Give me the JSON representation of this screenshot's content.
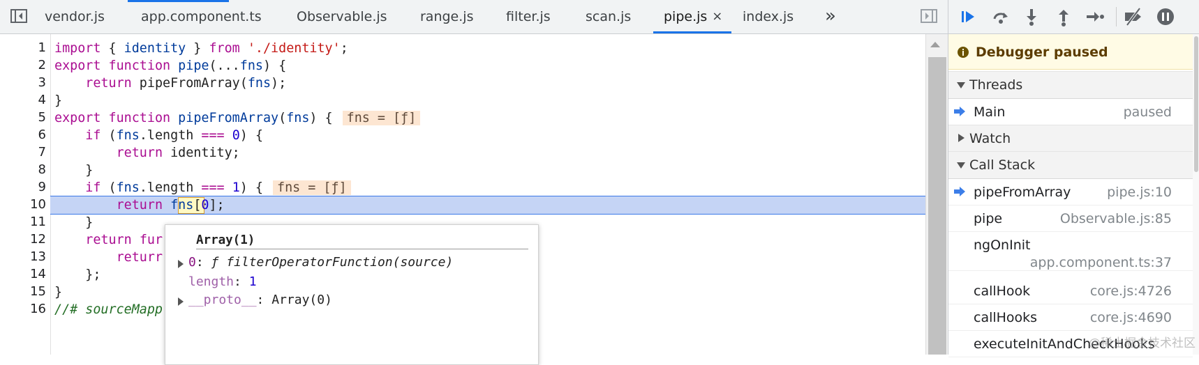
{
  "tabs": [
    {
      "label": "vendor.js",
      "active": false
    },
    {
      "label": "app.component.ts",
      "active": false
    },
    {
      "label": "Observable.js",
      "active": false
    },
    {
      "label": "range.js",
      "active": false
    },
    {
      "label": "filter.js",
      "active": false
    },
    {
      "label": "scan.js",
      "active": false
    },
    {
      "label": "pipe.js",
      "active": true
    },
    {
      "label": "index.js",
      "active": false
    }
  ],
  "tab_close_glyph": "×",
  "tab_overflow_glyph": "»",
  "editor": {
    "line_numbers": [
      "1",
      "2",
      "3",
      "4",
      "5",
      "6",
      "7",
      "8",
      "9",
      "10",
      "11",
      "12",
      "13",
      "14",
      "15",
      "16"
    ],
    "current_line": "10",
    "inline_values": {
      "line5": "fns = [ƒ]",
      "line9": "fns = [ƒ]"
    }
  },
  "popover": {
    "title": "Array(1)",
    "rows": [
      {
        "key": "0",
        "value": "ƒ filterOperatorFunction(source)"
      },
      {
        "key": "length",
        "value": "1"
      },
      {
        "key": "__proto__",
        "value": "Array(0)"
      }
    ]
  },
  "debugger": {
    "paused_label": "Debugger paused",
    "sections": {
      "threads": "Threads",
      "watch": "Watch",
      "call_stack": "Call Stack"
    },
    "threads": [
      {
        "name": "Main",
        "status": "paused"
      }
    ],
    "call_stack": [
      {
        "fn": "pipeFromArray",
        "loc": "pipe.js:10"
      },
      {
        "fn": "pipe",
        "loc": "Observable.js:85"
      },
      {
        "fn": "ngOnInit",
        "loc": "app.component.ts:37"
      },
      {
        "fn": "callHook",
        "loc": "core.js:4726"
      },
      {
        "fn": "callHooks",
        "loc": "core.js:4690"
      },
      {
        "fn": "executeInitAndCheckHooks",
        "loc": ""
      }
    ]
  },
  "watermark": "@稀土掘金技术社区",
  "colors": {
    "accent": "#1a73e8",
    "current_line_bg": "#c5d4f5",
    "paused_banner_bg": "#fffbe5",
    "keyword": "#aa0d91",
    "string": "#c41a16",
    "number": "#1c00cf"
  },
  "icons": {
    "toolbar": [
      "resume-icon",
      "step-over-icon",
      "step-into-icon",
      "step-out-icon",
      "step-icon",
      "deactivate-breakpoints-icon",
      "pause-on-exceptions-icon"
    ]
  }
}
